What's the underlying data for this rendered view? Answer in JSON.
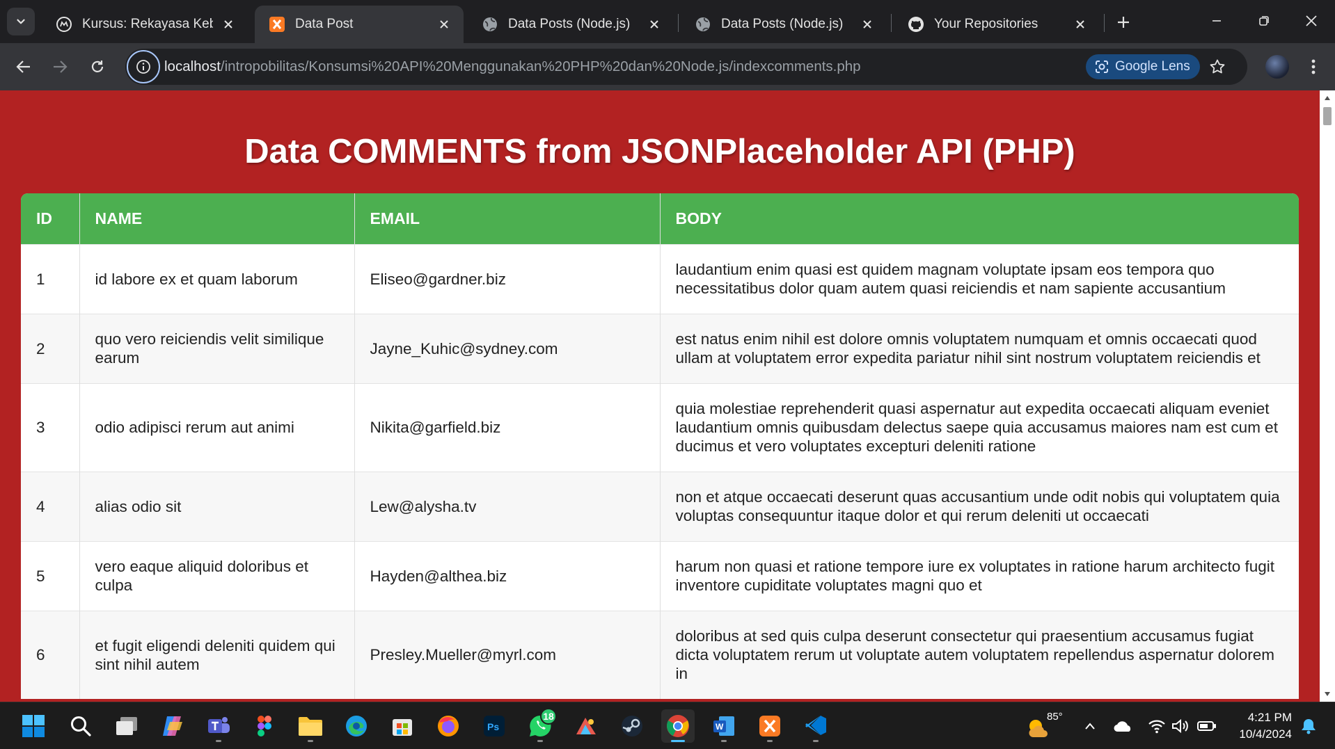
{
  "browser": {
    "tabs": [
      {
        "title": "Kursus: Rekayasa Kebutuhan",
        "icon": "moodle-icon",
        "active": false
      },
      {
        "title": "Data Post",
        "icon": "xampp-icon",
        "active": true
      },
      {
        "title": "Data Posts (Node.js)",
        "icon": "globe-icon",
        "active": false
      },
      {
        "title": "Data Posts (Node.js)",
        "icon": "globe-icon",
        "active": false
      },
      {
        "title": "Your Repositories",
        "icon": "github-icon",
        "active": false
      }
    ],
    "url_host": "localhost",
    "url_path": "/intropobilitas/Konsumsi%20API%20Menggunakan%20PHP%20dan%20Node.js/indexcomments.php",
    "lens_label": "Google Lens"
  },
  "page": {
    "title": "Data COMMENTS from JSONPlaceholder API (PHP)",
    "colors": {
      "background": "#b22222",
      "header": "#4caf50"
    },
    "table": {
      "headers": {
        "id": "ID",
        "name": "NAME",
        "email": "EMAIL",
        "body": "BODY"
      },
      "rows": [
        {
          "id": "1",
          "name": "id labore ex et quam laborum",
          "email": "Eliseo@gardner.biz",
          "body": "laudantium enim quasi est quidem magnam voluptate ipsam eos tempora quo necessitatibus dolor quam autem quasi reiciendis et nam sapiente accusantium"
        },
        {
          "id": "2",
          "name": "quo vero reiciendis velit similique earum",
          "email": "Jayne_Kuhic@sydney.com",
          "body": "est natus enim nihil est dolore omnis voluptatem numquam et omnis occaecati quod ullam at voluptatem error expedita pariatur nihil sint nostrum voluptatem reiciendis et"
        },
        {
          "id": "3",
          "name": "odio adipisci rerum aut animi",
          "email": "Nikita@garfield.biz",
          "body": "quia molestiae reprehenderit quasi aspernatur aut expedita occaecati aliquam eveniet laudantium omnis quibusdam delectus saepe quia accusamus maiores nam est cum et ducimus et vero voluptates excepturi deleniti ratione"
        },
        {
          "id": "4",
          "name": "alias odio sit",
          "email": "Lew@alysha.tv",
          "body": "non et atque occaecati deserunt quas accusantium unde odit nobis qui voluptatem quia voluptas consequuntur itaque dolor et qui rerum deleniti ut occaecati"
        },
        {
          "id": "5",
          "name": "vero eaque aliquid doloribus et culpa",
          "email": "Hayden@althea.biz",
          "body": "harum non quasi et ratione tempore iure ex voluptates in ratione harum architecto fugit inventore cupiditate voluptates magni quo et"
        },
        {
          "id": "6",
          "name": "et fugit eligendi deleniti quidem qui sint nihil autem",
          "email": "Presley.Mueller@myrl.com",
          "body": "doloribus at sed quis culpa deserunt consectetur qui praesentium accusamus fugiat dicta voluptatem rerum ut voluptate autem voluptatem repellendus aspernatur dolorem in"
        }
      ]
    }
  },
  "taskbar": {
    "whatsapp_badge": "18",
    "weather_temp": "85°",
    "time": "4:21 PM",
    "date": "10/4/2024"
  }
}
